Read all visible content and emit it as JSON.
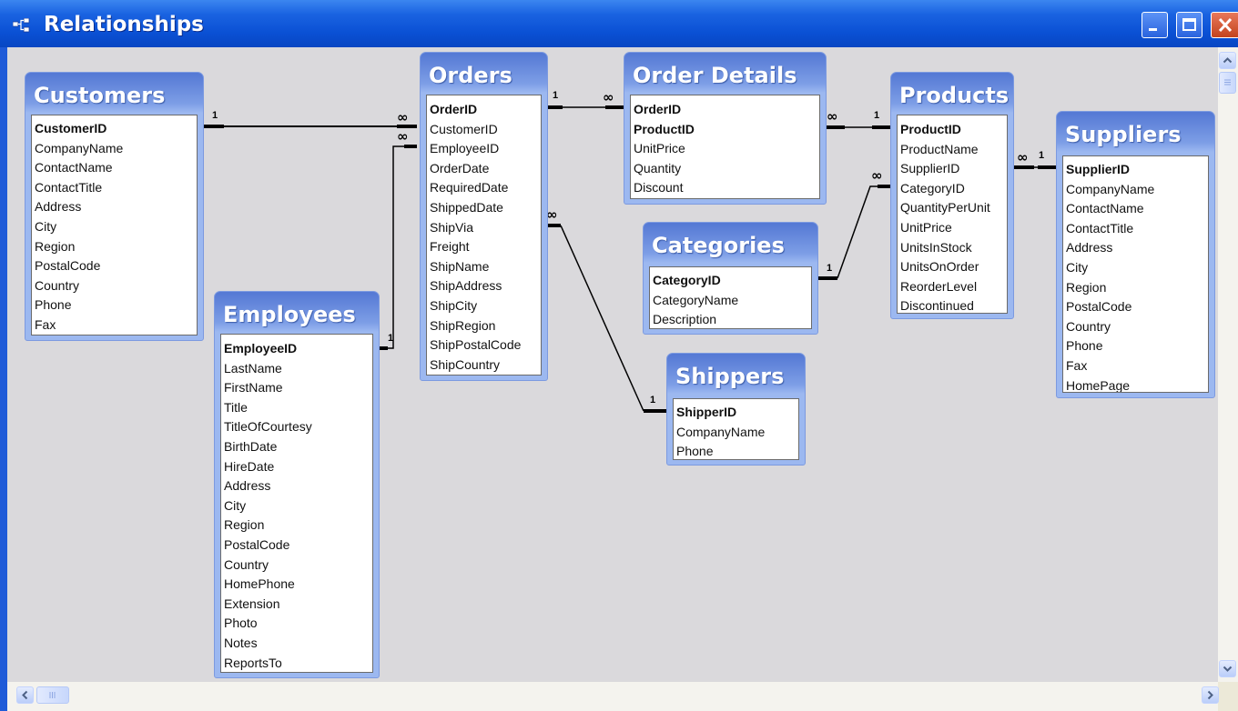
{
  "window": {
    "title": "Relationships"
  },
  "relation_labels": {
    "one": "1",
    "many": "∞"
  },
  "tables": {
    "customers": {
      "name": "Customers",
      "fields": [
        "CustomerID",
        "CompanyName",
        "ContactName",
        "ContactTitle",
        "Address",
        "City",
        "Region",
        "PostalCode",
        "Country",
        "Phone",
        "Fax"
      ]
    },
    "employees": {
      "name": "Employees",
      "fields": [
        "EmployeeID",
        "LastName",
        "FirstName",
        "Title",
        "TitleOfCourtesy",
        "BirthDate",
        "HireDate",
        "Address",
        "City",
        "Region",
        "PostalCode",
        "Country",
        "HomePhone",
        "Extension",
        "Photo",
        "Notes",
        "ReportsTo"
      ]
    },
    "orders": {
      "name": "Orders",
      "fields": [
        "OrderID",
        "CustomerID",
        "EmployeeID",
        "OrderDate",
        "RequiredDate",
        "ShippedDate",
        "ShipVia",
        "Freight",
        "ShipName",
        "ShipAddress",
        "ShipCity",
        "ShipRegion",
        "ShipPostalCode",
        "ShipCountry"
      ]
    },
    "order_details": {
      "name": "Order Details",
      "fields": [
        "OrderID",
        "ProductID",
        "UnitPrice",
        "Quantity",
        "Discount"
      ]
    },
    "categories": {
      "name": "Categories",
      "fields": [
        "CategoryID",
        "CategoryName",
        "Description"
      ]
    },
    "shippers": {
      "name": "Shippers",
      "fields": [
        "ShipperID",
        "CompanyName",
        "Phone"
      ]
    },
    "products": {
      "name": "Products",
      "fields": [
        "ProductID",
        "ProductName",
        "SupplierID",
        "CategoryID",
        "QuantityPerUnit",
        "UnitPrice",
        "UnitsInStock",
        "UnitsOnOrder",
        "ReorderLevel",
        "Discontinued"
      ]
    },
    "suppliers": {
      "name": "Suppliers",
      "fields": [
        "SupplierID",
        "CompanyName",
        "ContactName",
        "ContactTitle",
        "Address",
        "City",
        "Region",
        "PostalCode",
        "Country",
        "Phone",
        "Fax",
        "HomePage"
      ]
    }
  }
}
